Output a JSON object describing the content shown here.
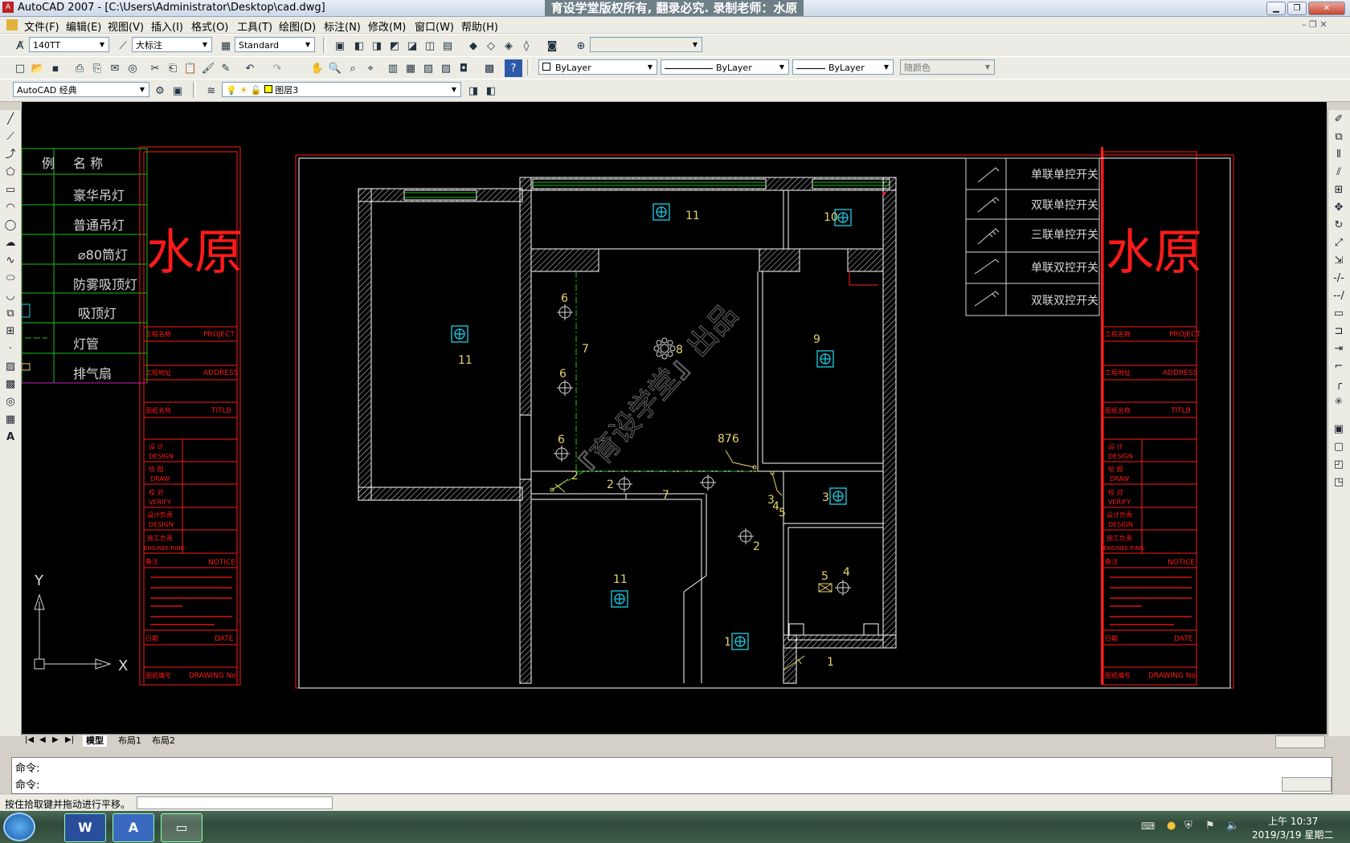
{
  "window": {
    "title": "AutoCAD 2007 - [C:\\Users\\Administrator\\Desktop\\cad.dwg]",
    "banner": "育设学堂版权所有, 翻录必究. 录制老师：水原"
  },
  "menu": [
    "文件(F)",
    "编辑(E)",
    "视图(V)",
    "插入(I)",
    "格式(O)",
    "工具(T)",
    "绘图(D)",
    "标注(N)",
    "修改(M)",
    "窗口(W)",
    "帮助(H)"
  ],
  "styles": {
    "text_style": "140TT",
    "dim_style": "大标注",
    "table_style": "Standard"
  },
  "properties": {
    "color": "ByLayer",
    "linetype": "ByLayer",
    "lineweight": "ByLayer",
    "plotstyle": "随颜色"
  },
  "workspace": "AutoCAD 经典",
  "layer": "图层3",
  "layout_tabs": [
    "模型",
    "布局1",
    "布局2"
  ],
  "command": {
    "line1": "命令:",
    "line2": "命令:"
  },
  "status_text": "按住拾取键并拖动进行平移。",
  "clock": {
    "time": "上午 10:37",
    "date": "2019/3/19 星期二"
  },
  "legend": {
    "header_left": "例",
    "header_name": "名    称",
    "items": [
      "豪华吊灯",
      "普通吊灯",
      "⌀80筒灯",
      "防雾吸顶灯",
      "吸顶灯",
      "灯管",
      "排气扇"
    ]
  },
  "switch_legend": [
    "单联单控开关",
    "双联单控开关",
    "三联单控开关",
    "单联双控开关",
    "双联双控开关"
  ],
  "title_block": {
    "name": "水原",
    "rows": [
      {
        "cn": "工程名称",
        "en": "PROJECT"
      },
      {
        "cn": "工程地址",
        "en": "ADDRESS"
      },
      {
        "cn": "图纸名称",
        "en": "TITLB"
      }
    ],
    "sign_rows": [
      {
        "cn": "设  计",
        "en": "DESIGN"
      },
      {
        "cn": "绘  图",
        "en": "DRAW"
      },
      {
        "cn": "校  对",
        "en": "VERIFY"
      },
      {
        "cn": "设计负责",
        "en": "DESIGN"
      },
      {
        "cn": "施工负责",
        "en": "ENGINEE RING"
      }
    ],
    "notice_cn": "备注",
    "notice_en": "NOTICE",
    "date_cn": "日期",
    "date_en": "DATE",
    "drawing_cn": "图纸编号",
    "drawing_en": "DRAWING No."
  },
  "watermark": "『育设学堂』出品",
  "ucs": {
    "x": "X",
    "y": "Y"
  },
  "plan_labels": [
    "11",
    "11",
    "10",
    "9",
    "8",
    "7",
    "7",
    "6",
    "6",
    "6",
    "2",
    "2",
    "2",
    "3",
    "3",
    "4",
    "5",
    "4",
    "5",
    "11",
    "1",
    "1",
    "876"
  ],
  "colors": {
    "canvas": "#000000",
    "frame_red": "#ff1a1a",
    "wall_white": "#ffffff",
    "fixture_cyan": "#18d0e8",
    "label_yellow": "#e6d46a",
    "wire_green": "#20c020"
  }
}
